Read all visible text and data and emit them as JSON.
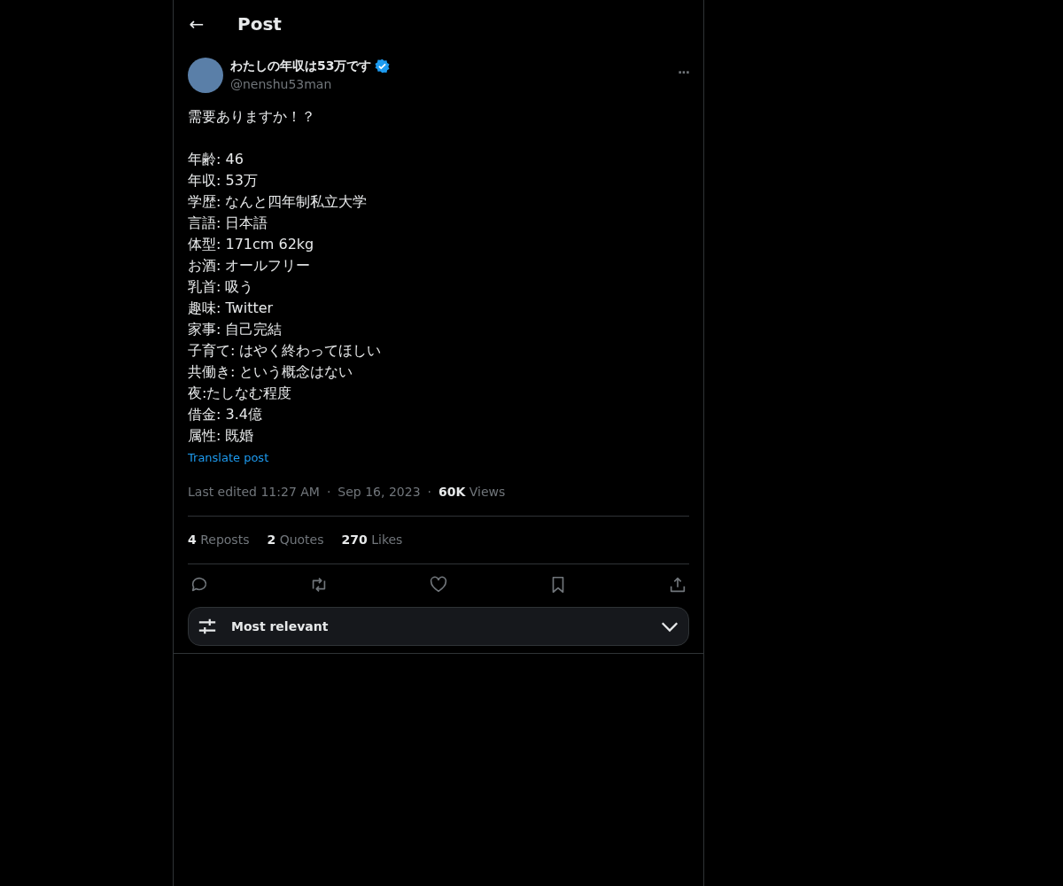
{
  "header": {
    "back": "←",
    "title": "Post"
  },
  "author": {
    "name": "わたしの年収は53万です",
    "verified": true,
    "handle": "@nenshu53man",
    "more": "···"
  },
  "paragraphs": [
    [
      "需要ありますか！？"
    ],
    [
      "年齢: 46",
      "年収: 53万",
      "学歴: なんと四年制私立大学",
      "言語: 日本語",
      "体型: 171cm 62kg",
      "お酒: オールフリー",
      "乳首: 吸う",
      "趣味: Twitter",
      "家事: 自己完結",
      "子育て: はやく終わってほしい",
      "共働き: という概念はない",
      "夜:たしなむ程度",
      "借金: 3.4億",
      "属性: 既婚"
    ]
  ],
  "translate": "Translate post",
  "meta": {
    "edited": "Last edited 11:27 AM",
    "separators": [
      "·",
      "·"
    ],
    "date": "Sep 16, 2023",
    "views_count": "60K",
    "views_label": "Views"
  },
  "stats": [
    {
      "count": "4",
      "label": "Reposts"
    },
    {
      "count": "2",
      "label": "Quotes"
    },
    {
      "count": "270",
      "label": "Likes"
    }
  ],
  "actions": [
    {
      "kind": "reply"
    },
    {
      "kind": "repost"
    },
    {
      "kind": "like"
    },
    {
      "kind": "bookmark"
    },
    {
      "kind": "share"
    }
  ],
  "sort": {
    "label": "Most relevant"
  }
}
